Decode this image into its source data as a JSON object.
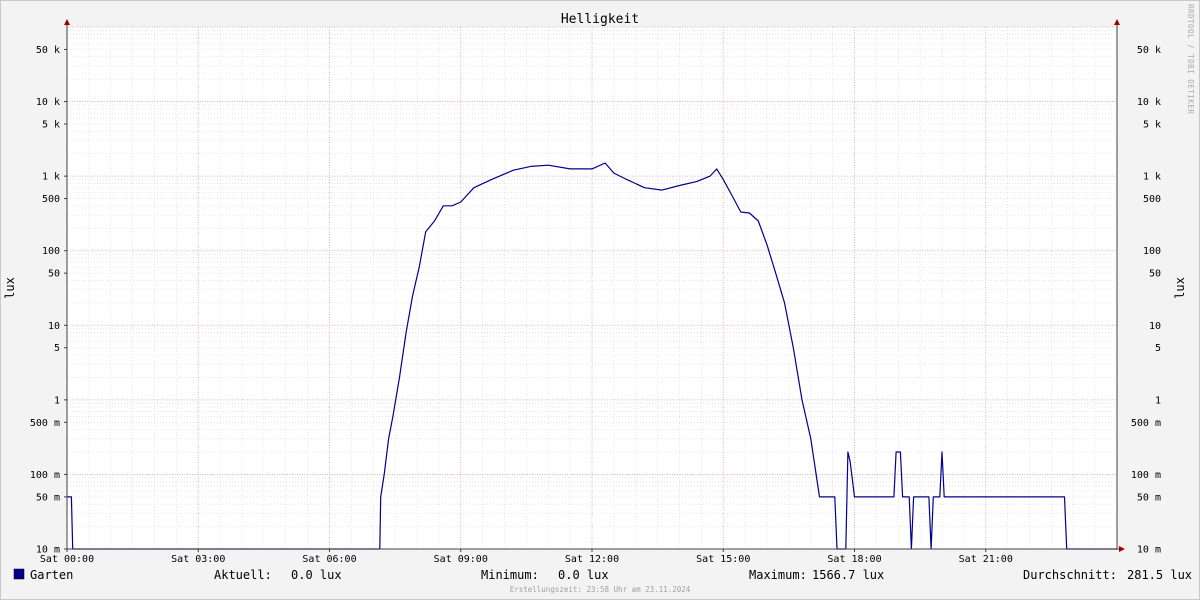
{
  "chart_data": {
    "type": "line",
    "title": "Helligkeit",
    "ylabel": "lux",
    "y_scale": "log",
    "ylim": [
      0.01,
      100000
    ],
    "y_ticks": [
      {
        "value": 50000,
        "label": "50 k"
      },
      {
        "value": 10000,
        "label": "10 k"
      },
      {
        "value": 5000,
        "label": "5 k"
      },
      {
        "value": 1000,
        "label": "1 k"
      },
      {
        "value": 500,
        "label": "500"
      },
      {
        "value": 100,
        "label": "100"
      },
      {
        "value": 50,
        "label": "50"
      },
      {
        "value": 10,
        "label": "10"
      },
      {
        "value": 5,
        "label": "5"
      },
      {
        "value": 1,
        "label": "1"
      },
      {
        "value": 0.5,
        "label": "500 m"
      },
      {
        "value": 0.1,
        "label": "100 m"
      },
      {
        "value": 0.05,
        "label": "50 m"
      },
      {
        "value": 0.01,
        "label": "10 m"
      }
    ],
    "xlim": [
      "00:00",
      "24:00"
    ],
    "x_ticks": [
      {
        "hour": 0,
        "label": "Sat 00:00"
      },
      {
        "hour": 3,
        "label": "Sat 03:00"
      },
      {
        "hour": 6,
        "label": "Sat 06:00"
      },
      {
        "hour": 9,
        "label": "Sat 09:00"
      },
      {
        "hour": 12,
        "label": "Sat 12:00"
      },
      {
        "hour": 15,
        "label": "Sat 15:00"
      },
      {
        "hour": 18,
        "label": "Sat 18:00"
      },
      {
        "hour": 21,
        "label": "Sat 21:00"
      }
    ],
    "grid": true,
    "series": [
      {
        "name": "Garten",
        "color": "#00008b",
        "points": [
          [
            0.0,
            0.05
          ],
          [
            0.1,
            0.05
          ],
          [
            0.13,
            0.01
          ],
          [
            7.15,
            0.01
          ],
          [
            7.17,
            0.05
          ],
          [
            7.25,
            0.1
          ],
          [
            7.35,
            0.3
          ],
          [
            7.45,
            0.6
          ],
          [
            7.6,
            2
          ],
          [
            7.75,
            8
          ],
          [
            7.9,
            25
          ],
          [
            8.05,
            60
          ],
          [
            8.2,
            180
          ],
          [
            8.4,
            250
          ],
          [
            8.6,
            400
          ],
          [
            8.8,
            400
          ],
          [
            9.0,
            450
          ],
          [
            9.3,
            700
          ],
          [
            9.7,
            900
          ],
          [
            10.2,
            1200
          ],
          [
            10.6,
            1350
          ],
          [
            11.0,
            1400
          ],
          [
            11.5,
            1250
          ],
          [
            12.0,
            1250
          ],
          [
            12.3,
            1500
          ],
          [
            12.5,
            1100
          ],
          [
            12.8,
            900
          ],
          [
            13.2,
            700
          ],
          [
            13.6,
            650
          ],
          [
            14.0,
            750
          ],
          [
            14.4,
            850
          ],
          [
            14.7,
            1000
          ],
          [
            14.85,
            1250
          ],
          [
            15.0,
            900
          ],
          [
            15.2,
            550
          ],
          [
            15.4,
            330
          ],
          [
            15.6,
            320
          ],
          [
            15.8,
            250
          ],
          [
            16.0,
            120
          ],
          [
            16.2,
            50
          ],
          [
            16.4,
            20
          ],
          [
            16.6,
            5
          ],
          [
            16.8,
            1
          ],
          [
            17.0,
            0.3
          ],
          [
            17.2,
            0.05
          ],
          [
            17.55,
            0.05
          ],
          [
            17.6,
            0.01
          ],
          [
            17.8,
            0.01
          ],
          [
            17.85,
            0.2
          ],
          [
            17.9,
            0.15
          ],
          [
            18.0,
            0.05
          ],
          [
            18.9,
            0.05
          ],
          [
            18.95,
            0.2
          ],
          [
            19.05,
            0.2
          ],
          [
            19.1,
            0.05
          ],
          [
            19.25,
            0.05
          ],
          [
            19.3,
            0.01
          ],
          [
            19.35,
            0.05
          ],
          [
            19.7,
            0.05
          ],
          [
            19.75,
            0.01
          ],
          [
            19.8,
            0.05
          ],
          [
            19.95,
            0.05
          ],
          [
            20.0,
            0.2
          ],
          [
            20.05,
            0.05
          ],
          [
            22.8,
            0.05
          ],
          [
            22.85,
            0.01
          ],
          [
            24.0,
            0.01
          ]
        ]
      }
    ],
    "legend": [
      {
        "name": "Garten",
        "color": "#00008b"
      }
    ],
    "stats": {
      "aktuell_label": "Aktuell:",
      "aktuell_value": "0.0 lux",
      "minimum_label": "Minimum:",
      "minimum_value": "0.0 lux",
      "maximum_label": "Maximum:",
      "maximum_value": "1566.7 lux",
      "durchschnitt_label": "Durchschnitt:",
      "durchschnitt_value": "281.5 lux"
    },
    "footer": "Erstellungszeit: 23:58 Uhr am 23.11.2024",
    "watermark": "RRDTOOL / TOBI OETIKER"
  }
}
